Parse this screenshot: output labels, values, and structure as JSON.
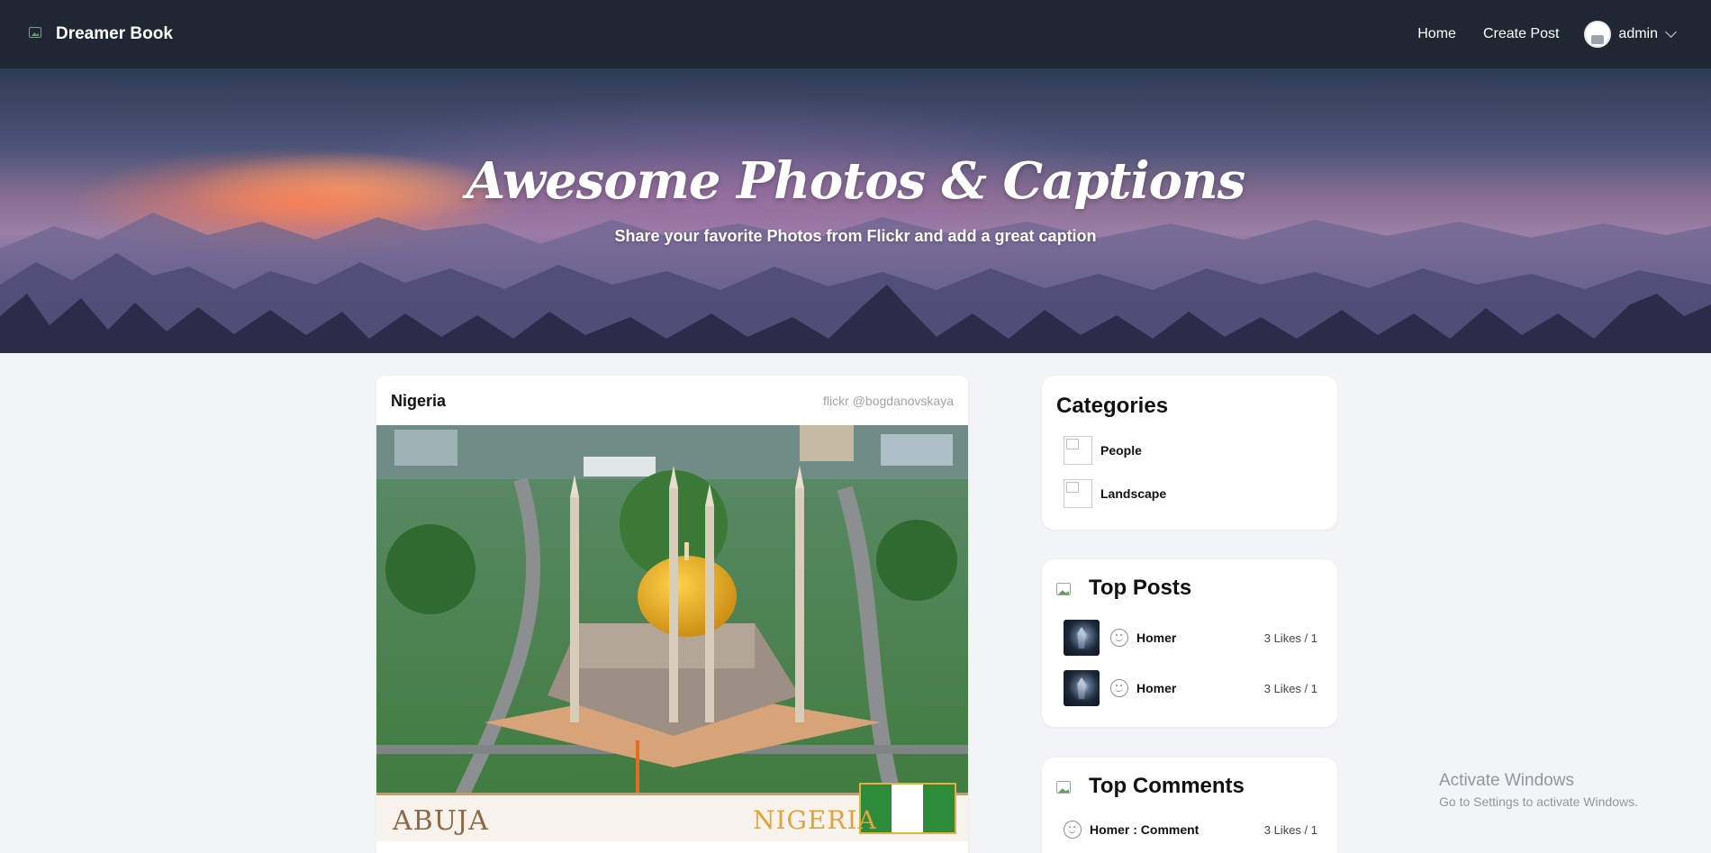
{
  "navbar": {
    "brand": "Dreamer Book",
    "links": [
      {
        "label": "Home"
      },
      {
        "label": "Create Post"
      }
    ],
    "user": {
      "name": "admin"
    }
  },
  "hero": {
    "title": "Awesome Photos & Captions",
    "subtitle": "Share your favorite Photos from Flickr and add a great caption"
  },
  "post": {
    "title": "Nigeria",
    "credit": "flickr @bogdanovskaya",
    "image_labels": {
      "left": "ABUJA",
      "right": "NIGERIA"
    }
  },
  "categories": {
    "title": "Categories",
    "items": [
      {
        "label": "People"
      },
      {
        "label": "Landscape"
      }
    ]
  },
  "top_posts": {
    "title": "Top Posts",
    "items": [
      {
        "name": "Homer",
        "stats": "3 Likes / 1"
      },
      {
        "name": "Homer",
        "stats": "3 Likes / 1"
      }
    ]
  },
  "top_comments": {
    "title": "Top Comments",
    "items": [
      {
        "name": "Homer : Comment",
        "stats": "3 Likes / 1"
      }
    ]
  },
  "watermark": {
    "line1": "Activate Windows",
    "line2": "Go to Settings to activate Windows."
  }
}
